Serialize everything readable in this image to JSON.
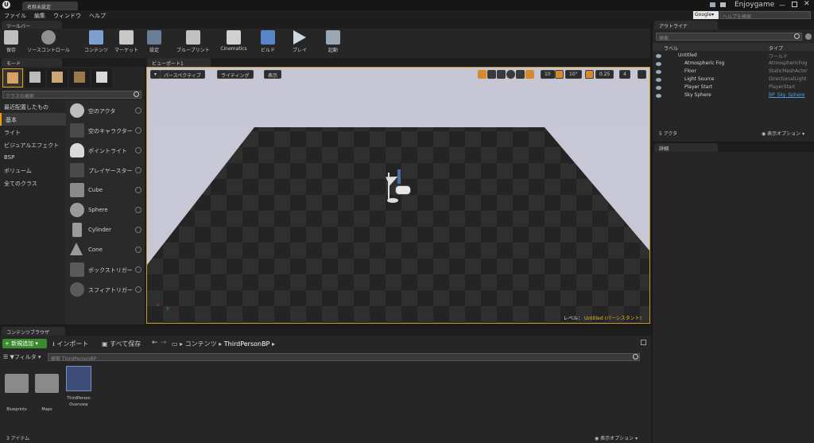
{
  "window": {
    "tab_title": "名称未設定",
    "app_name": "Enjoygame",
    "help_search_placeholder": "ヘルプを検索",
    "search_engine": "Google"
  },
  "menu": [
    "ファイル",
    "編集",
    "ウィンドウ",
    "ヘルプ"
  ],
  "toolbar": {
    "tab": "ツールバー",
    "buttons": [
      {
        "label": "保存",
        "icon": "save-icon"
      },
      {
        "label": "ソースコントロール",
        "icon": "source-control-icon"
      },
      {
        "label": "コンテンツ",
        "icon": "content-icon"
      },
      {
        "label": "マーケット",
        "icon": "marketplace-icon"
      },
      {
        "label": "設定",
        "icon": "settings-icon"
      },
      {
        "label": "ブループリント",
        "icon": "blueprint-icon"
      },
      {
        "label": "Cinematics",
        "icon": "cinematics-icon"
      },
      {
        "label": "ビルド",
        "icon": "build-icon"
      },
      {
        "label": "プレイ",
        "icon": "play-icon"
      },
      {
        "label": "起動",
        "icon": "launch-icon"
      }
    ]
  },
  "modes": {
    "tab": "モード",
    "search_placeholder": "クラスの検索",
    "categories": [
      "最近配置したもの",
      "基本",
      "ライト",
      "ビジュアルエフェクト",
      "BSP",
      "ボリューム",
      "全てのクラス"
    ],
    "selected_category": "基本",
    "items": [
      "空のアクタ",
      "空のキャラクター",
      "ポイントライト",
      "プレイヤースター",
      "Cube",
      "Sphere",
      "Cylinder",
      "Cone",
      "ボックストリガー",
      "スフィアトリガー"
    ]
  },
  "viewport": {
    "tab": "ビューポート1",
    "perspective": "パースペクティブ",
    "lighting": "ライティング",
    "show": "表示",
    "grid_snap": "10",
    "rot_snap": "10°",
    "scale_snap": "0.25",
    "cam_speed": "4",
    "level_label": "レベル：",
    "level_value": "Untitled (パーシスタント)",
    "axis_x": "x",
    "axis_y": "y"
  },
  "outliner": {
    "tab": "アウトライナ",
    "search_placeholder": "検索",
    "col_label": "ラベル",
    "col_type": "タイプ",
    "rows": [
      {
        "label": "Untitled",
        "type": "ワールド"
      },
      {
        "label": "Atmospheric Fog",
        "type": "AtmosphericFog"
      },
      {
        "label": "Floor",
        "type": "StaticMeshActor"
      },
      {
        "label": "Light Source",
        "type": "DirectionalLight"
      },
      {
        "label": "Player Start",
        "type": "PlayerStart"
      },
      {
        "label": "Sky Sphere",
        "type": "BP_Sky_Sphere"
      }
    ],
    "count": "5 アクタ",
    "view_options": "表示オプション"
  },
  "details": {
    "tab": "詳細"
  },
  "content_browser": {
    "tab": "コンテンツブラウザ",
    "add_new": "新規追加",
    "import": "インポート",
    "save_all": "すべて保存",
    "path": [
      "コンテンツ",
      "ThirdPersonBP"
    ],
    "filter": "フィルタ",
    "search_placeholder": "検索 ThirdPersonBP",
    "assets": [
      {
        "name": "Blueprints",
        "kind": "folder"
      },
      {
        "name": "Maps",
        "kind": "folder"
      },
      {
        "name": "ThirdPerson Overview",
        "kind": "asset"
      }
    ],
    "count": "3 アイテム",
    "view_options": "表示オプション"
  }
}
